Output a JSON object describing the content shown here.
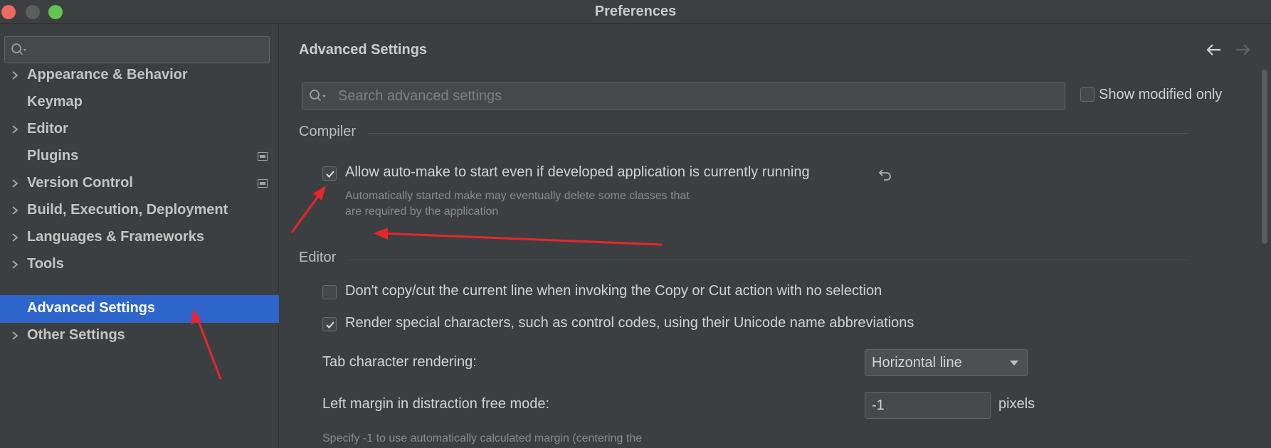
{
  "window": {
    "title": "Preferences"
  },
  "sidebar": {
    "search_placeholder": "",
    "items": [
      {
        "label": "Appearance & Behavior",
        "expandable": true
      },
      {
        "label": "Keymap",
        "expandable": false
      },
      {
        "label": "Editor",
        "expandable": true
      },
      {
        "label": "Plugins",
        "expandable": false
      },
      {
        "label": "Version Control",
        "expandable": true
      },
      {
        "label": "Build, Execution, Deployment",
        "expandable": true
      },
      {
        "label": "Languages & Frameworks",
        "expandable": true
      },
      {
        "label": "Tools",
        "expandable": true
      },
      {
        "label": "Advanced Settings",
        "expandable": false,
        "selected": true
      },
      {
        "label": "Other Settings",
        "expandable": true
      }
    ]
  },
  "main": {
    "title": "Advanced Settings",
    "search_placeholder": "Search advanced settings",
    "show_modified_label": "Show modified only",
    "show_modified_checked": false,
    "sections": {
      "compiler": {
        "label": "Compiler",
        "option": {
          "label": "Allow auto-make to start even if developed application is currently running",
          "checked": true,
          "desc_line1": "Automatically started make may eventually delete some classes that",
          "desc_line2": "are required by the application"
        }
      },
      "editor": {
        "label": "Editor",
        "copy_option": {
          "label": "Don't copy/cut the current line when invoking the Copy or Cut action with no selection",
          "checked": false
        },
        "render_option": {
          "label": "Render special characters, such as control codes, using their Unicode name abbreviations",
          "checked": true
        },
        "tab_rendering": {
          "label": "Tab character rendering:",
          "value": "Horizontal line"
        },
        "left_margin": {
          "label": "Left margin in distraction free mode:",
          "value": "-1",
          "unit": "pixels",
          "desc": "Specify -1 to use automatically calculated margin (centering the"
        }
      }
    }
  },
  "colors": {
    "accent": "#2e65ca",
    "annotation": "#e8262b"
  }
}
